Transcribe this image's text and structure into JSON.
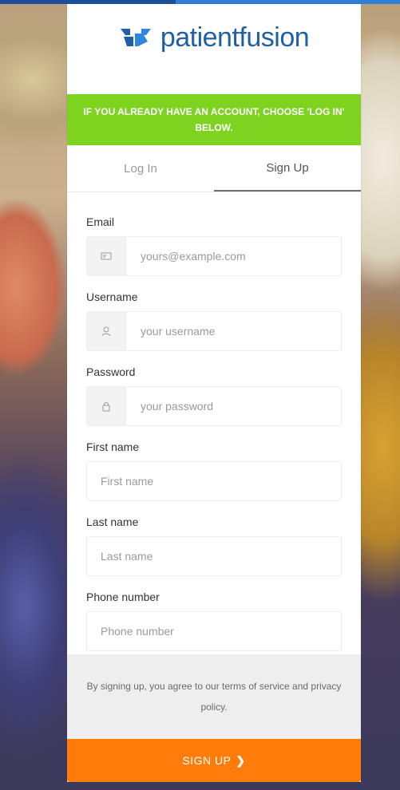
{
  "brand": {
    "logo_text_1": "patient",
    "logo_text_2": "fusion"
  },
  "banner": {
    "text": "IF YOU ALREADY HAVE AN ACCOUNT, CHOOSE 'LOG IN' BELOW."
  },
  "tabs": [
    {
      "label": "Log In"
    },
    {
      "label": "Sign Up"
    }
  ],
  "form": {
    "email": {
      "label": "Email",
      "placeholder": "yours@example.com",
      "icon": "email-card-icon"
    },
    "username": {
      "label": "Username",
      "placeholder": "your username",
      "icon": "user-icon"
    },
    "password": {
      "label": "Password",
      "placeholder": "your password",
      "icon": "lock-icon"
    },
    "first_name": {
      "label": "First name",
      "placeholder": "First name"
    },
    "last_name": {
      "label": "Last name",
      "placeholder": "Last name"
    },
    "phone": {
      "label": "Phone number",
      "placeholder": "Phone number"
    }
  },
  "terms": {
    "text": "By signing up, you agree to our terms of service and privacy policy."
  },
  "cta": {
    "label": "SIGN UP",
    "chevron": "❯"
  },
  "colors": {
    "accent_green": "#7ED321",
    "cta_orange": "#FF7C0A",
    "brand_blue": "#1F5FA6"
  }
}
